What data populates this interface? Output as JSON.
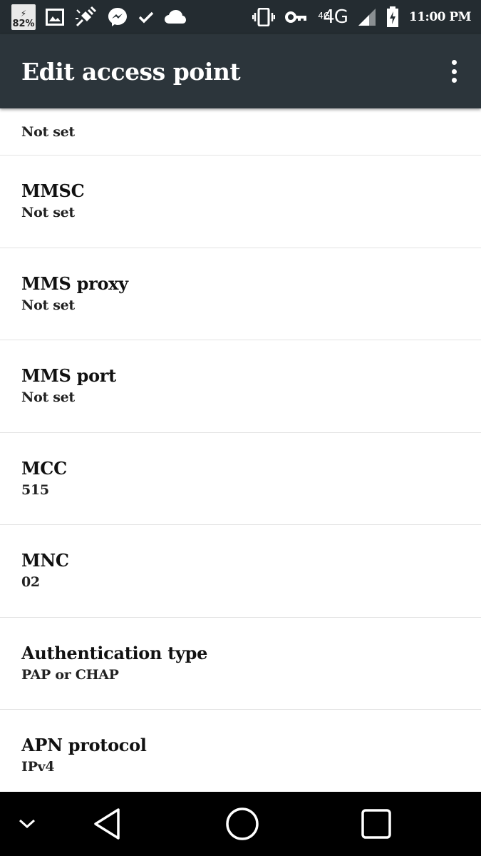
{
  "status_bar": {
    "battery_percent": "82%",
    "network_small": "4G",
    "network_large": "4G",
    "time": "11:00 PM",
    "icons": [
      "battery-saver-icon",
      "image-icon",
      "usb-debug-icon",
      "messenger-icon",
      "check-icon",
      "cloud-icon",
      "vibrate-icon",
      "vpn-key-icon",
      "signal-icon",
      "battery-icon"
    ]
  },
  "app_bar": {
    "title": "Edit access point",
    "menu_icon": "more-vert-icon"
  },
  "list": {
    "partial_value": "Not set",
    "items": [
      {
        "title": "MMSC",
        "value": "Not set"
      },
      {
        "title": "MMS proxy",
        "value": "Not set"
      },
      {
        "title": "MMS port",
        "value": "Not set"
      },
      {
        "title": "MCC",
        "value": "515"
      },
      {
        "title": "MNC",
        "value": "02"
      },
      {
        "title": "Authentication type",
        "value": "PAP or CHAP"
      },
      {
        "title": "APN protocol",
        "value": "IPv4"
      }
    ]
  },
  "nav_bar": {
    "icons": [
      "collapse-icon",
      "back-icon",
      "home-icon",
      "recents-icon"
    ]
  }
}
